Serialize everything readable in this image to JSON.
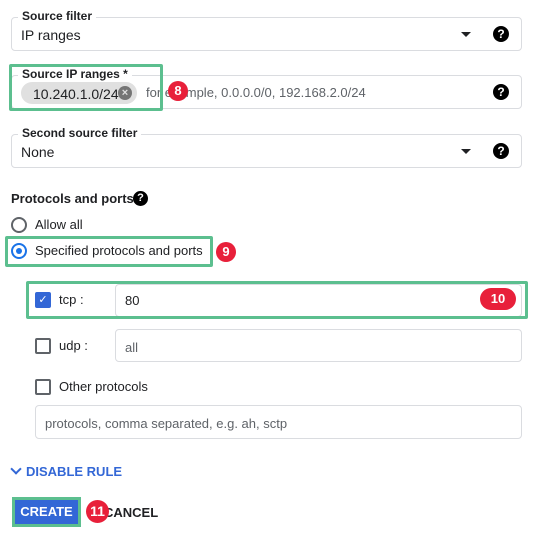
{
  "source_filter": {
    "label": "Source filter",
    "value": "IP ranges"
  },
  "source_ip": {
    "label": "Source IP ranges *",
    "chip": "10.240.1.0/24",
    "placeholder": "for example, 0.0.0.0/0, 192.168.2.0/24"
  },
  "second_filter": {
    "label": "Second source filter",
    "value": "None"
  },
  "protocols": {
    "heading": "Protocols and ports",
    "allow_all": "Allow all",
    "specified": "Specified protocols and ports",
    "tcp_label": "tcp :",
    "tcp_value": "80",
    "udp_label": "udp :",
    "udp_placeholder": "all",
    "other_label": "Other protocols",
    "other_placeholder": "protocols, comma separated, e.g. ah, sctp"
  },
  "disable_rule": "DISABLE RULE",
  "create": "CREATE",
  "cancel": "CANCEL",
  "badges": {
    "b8": "8",
    "b9": "9",
    "b10": "10",
    "b11": "11"
  },
  "help": "?"
}
